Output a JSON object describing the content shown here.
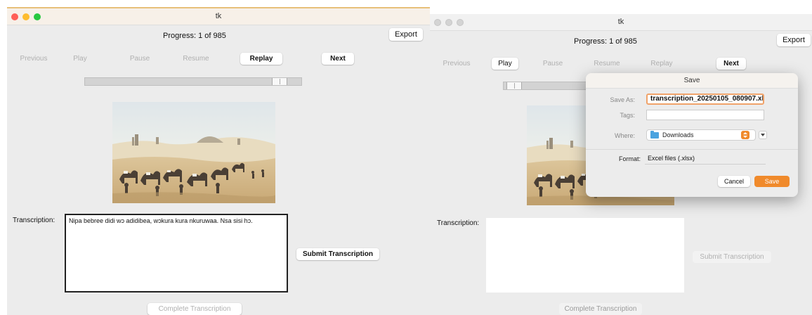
{
  "left": {
    "window_title": "tk",
    "progress": "Progress: 1 of 985",
    "buttons": {
      "export": "Export",
      "previous": "Previous",
      "play": "Play",
      "pause": "Pause",
      "resume": "Resume",
      "replay": "Replay",
      "next": "Next",
      "submit": "Submit Transcription",
      "complete": "Complete Transcription"
    },
    "transcription_label": "Transcription:",
    "transcription_text": "Nipa bebree didi wɔ adidibea, wɔkura kura nkuruwaa. Nsa sisi hɔ.",
    "slider_value": 0.93
  },
  "right": {
    "window_title": "tk",
    "progress": "Progress: 1 of 985",
    "buttons": {
      "export": "Export",
      "previous": "Previous",
      "play": "Play",
      "pause": "Pause",
      "resume": "Resume",
      "replay": "Replay",
      "next": "Next",
      "submit": "Submit Transcription",
      "complete": "Complete Transcription"
    },
    "transcription_label": "Transcription:",
    "slider_value": 0.02,
    "save_dialog": {
      "title": "Save",
      "save_as_label": "Save As:",
      "save_as_value": "transcription_20250105_080907.xl",
      "tags_label": "Tags:",
      "where_label": "Where:",
      "where_value": "Downloads",
      "format_label": "Format:",
      "format_value": "Excel files (.xlsx)",
      "cancel": "Cancel",
      "save": "Save"
    }
  },
  "colors": {
    "accent": "#f08a2b",
    "folder": "#4aa3df",
    "window_bg": "#ececec"
  },
  "icons": [
    "close-light",
    "minimize-light",
    "zoom-light",
    "folder-icon",
    "updown-icon",
    "chevron-down-icon"
  ]
}
